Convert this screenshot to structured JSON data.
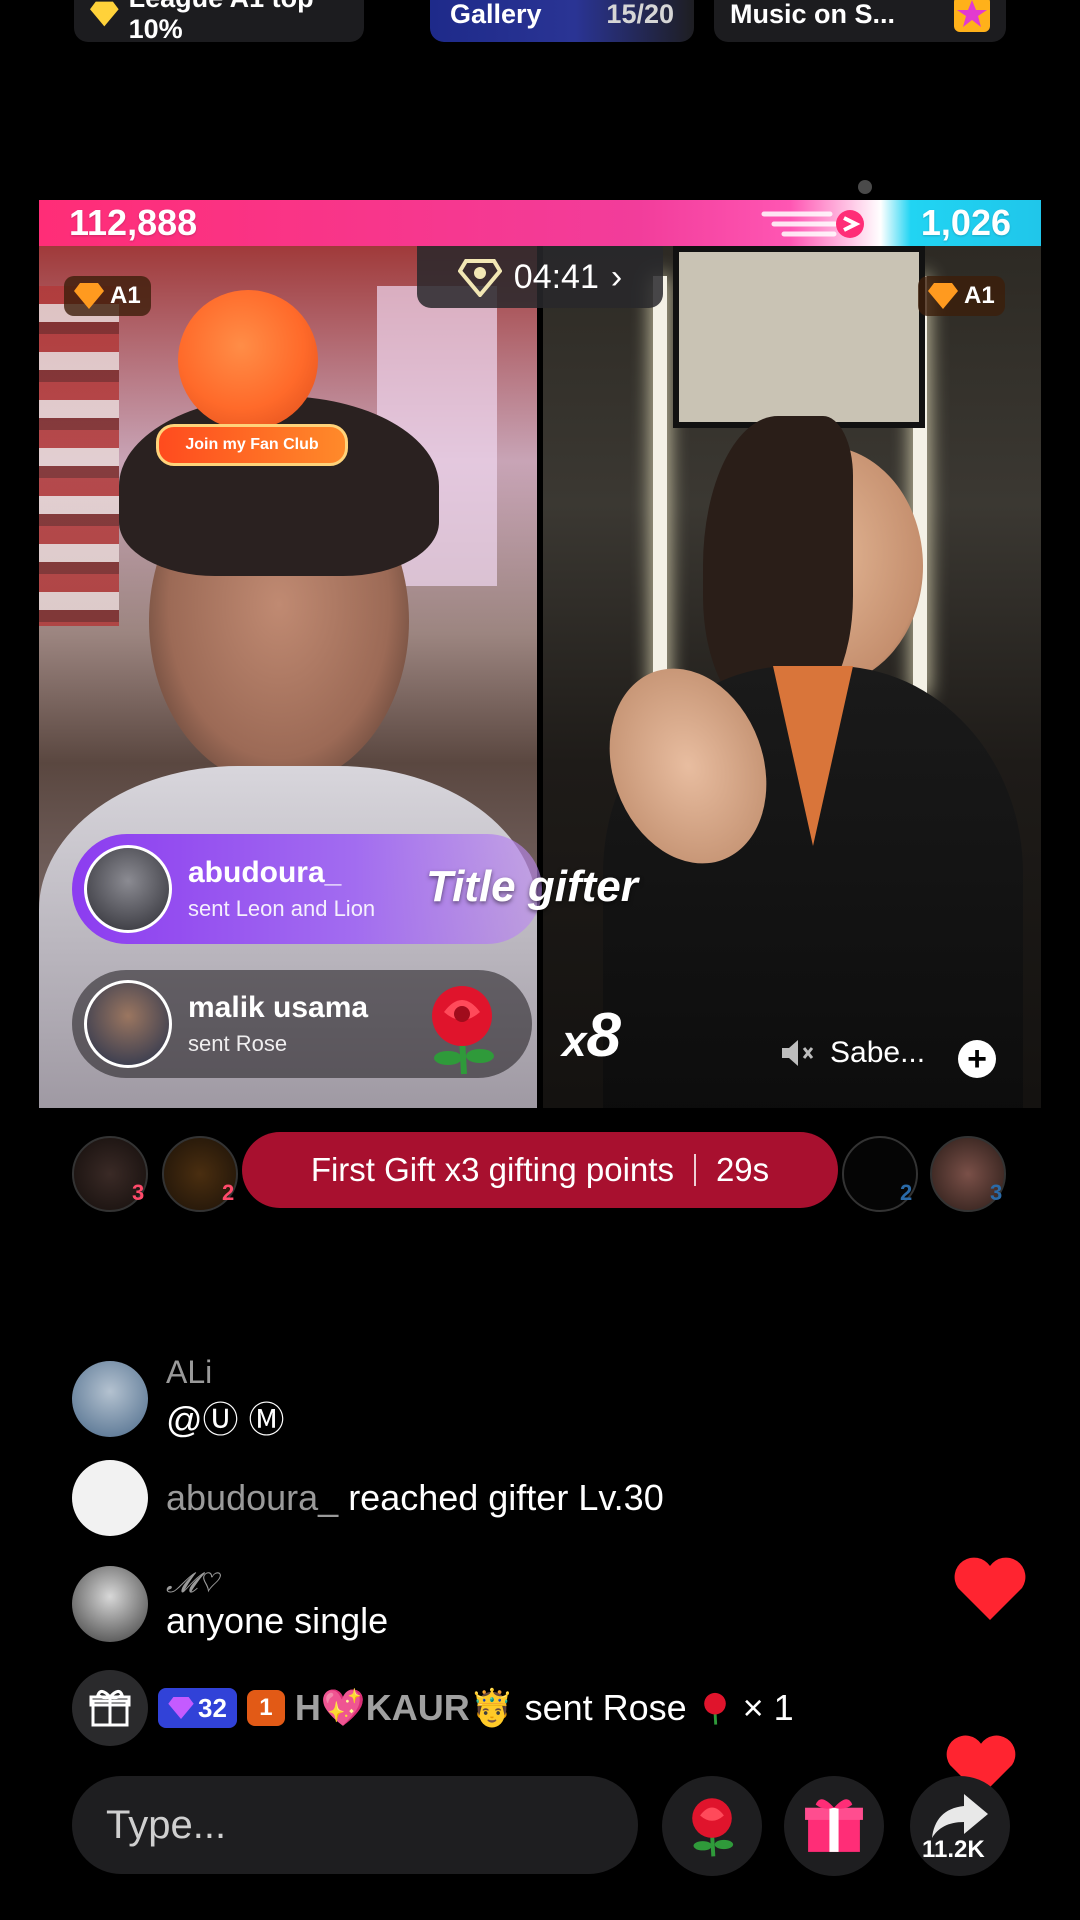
{
  "top_pills": {
    "league": "League A1 top 10%",
    "gallery_label": "Gallery",
    "gallery_count": "15/20",
    "music": "Music on S..."
  },
  "battle": {
    "left_score": "112,888",
    "right_score": "1,026",
    "timer": "04:41",
    "left_badge": "A1",
    "right_badge": "A1",
    "fan_club": "Join my Fan Club"
  },
  "gifts": [
    {
      "name": "abudoura_",
      "sub": "sent Leon and Lion"
    },
    {
      "name": "malik usama",
      "sub": "sent Rose"
    }
  ],
  "overlay": {
    "title_gifter": "Title gifter",
    "combo_prefix": "x",
    "combo_count": "8",
    "guest_name": "Sabe..."
  },
  "banner": {
    "text": "First Gift x3 gifting points",
    "countdown": "29s",
    "left_counts": [
      "3",
      "2"
    ],
    "right_counts": [
      "2",
      "3"
    ]
  },
  "chat": [
    {
      "user": "ALi",
      "message": "@Ⓤ Ⓜ"
    },
    {
      "user": "abudoura_",
      "message": "reached gifter Lv.30"
    },
    {
      "user": "𝓜♡",
      "message": "anyone single"
    }
  ],
  "ticker": {
    "level": "32",
    "rank": "1",
    "user": "H💖KAUR🤴",
    "action": "sent Rose",
    "count": "× 1"
  },
  "bottom": {
    "placeholder": "Type...",
    "share_count": "11.2K"
  },
  "colors": {
    "left_team": "#ff2d77",
    "right_team": "#20c6ea",
    "banner": "#a8102f",
    "heart": "#ff2430"
  }
}
